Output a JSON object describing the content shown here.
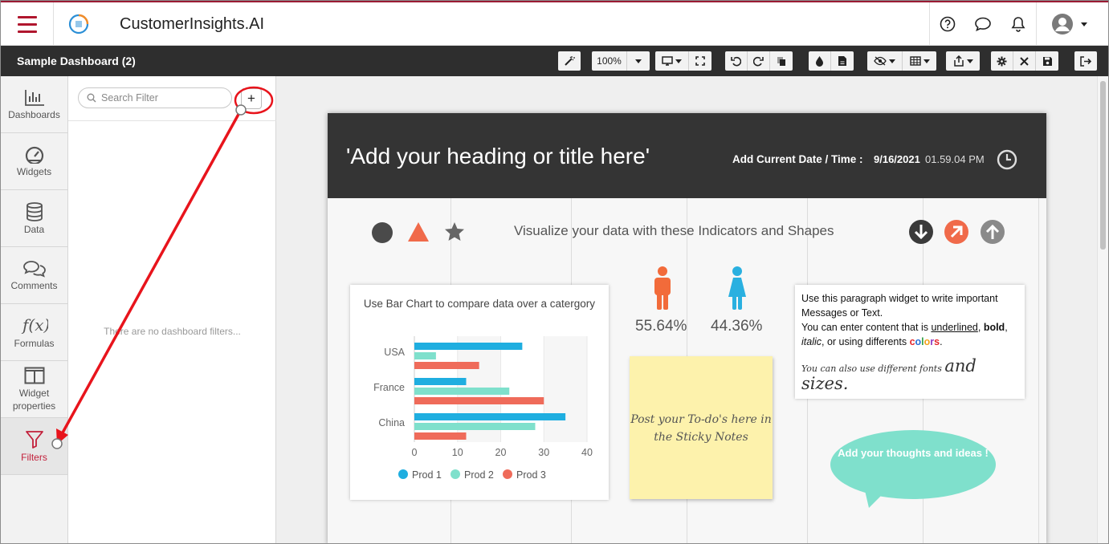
{
  "app": {
    "title": "CustomerInsights.AI",
    "logo_text": "customer insights"
  },
  "header": {
    "icons": [
      "help-icon",
      "chat-icon",
      "bell-icon",
      "user-avatar-icon"
    ]
  },
  "toolbar": {
    "dashboard_title": "Sample Dashboard (2)",
    "zoom": "100%"
  },
  "nav": {
    "items": [
      {
        "label": "Dashboards",
        "icon": "bar-chart-icon"
      },
      {
        "label": "Widgets",
        "icon": "gauge-icon"
      },
      {
        "label": "Data",
        "icon": "database-icon"
      },
      {
        "label": "Comments",
        "icon": "comments-icon"
      },
      {
        "label": "Formulas",
        "icon": "function-icon"
      },
      {
        "label": "Widget properties",
        "icon": "columns-icon"
      },
      {
        "label": "Filters",
        "icon": "filter-icon"
      }
    ],
    "active": "Filters"
  },
  "filter_panel": {
    "search_placeholder": "Search Filter",
    "add_label": "+",
    "empty_message": "There are no dashboard filters..."
  },
  "board": {
    "heading": "'Add your heading or title here'",
    "date_label": "Add Current Date / Time :",
    "date": "9/16/2021",
    "time": "01.59.04 PM",
    "indicators_text": "Visualize your data with these Indicators and Shapes",
    "male_pct": "55.64%",
    "female_pct": "44.36%",
    "paragraph": {
      "line1": "Use this paragraph widget to write important Messages or Text.",
      "line2_pre": "You can enter content that is ",
      "underlined": "underlined",
      "comma1": ", ",
      "bold": "bold",
      "comma2": ",",
      "italic": "italic",
      "line3_mid": ", or using differents ",
      "colors": "colors",
      "period": ".",
      "fonts": "You can also use different fonts",
      "sizes": "and sizes."
    },
    "sticky_note": "Post your To-do's here in the Sticky Notes",
    "bubble": "Add your thoughts and ideas !",
    "colors": {
      "accent": "#c21f3a",
      "orange": "#f26b3a",
      "blue": "#2ab0e0",
      "teal": "#7fe0cc",
      "sticky": "#fdf2ac"
    }
  },
  "chart_data": {
    "type": "bar",
    "orientation": "horizontal",
    "title": "Use Bar Chart to compare data over a catergory",
    "categories": [
      "USA",
      "France",
      "China"
    ],
    "series": [
      {
        "name": "Prod 1",
        "color": "#1faee0",
        "values": [
          25,
          12,
          35
        ]
      },
      {
        "name": "Prod 2",
        "color": "#7fe0cc",
        "values": [
          5,
          22,
          28
        ]
      },
      {
        "name": "Prod 3",
        "color": "#ef6b5a",
        "values": [
          15,
          30,
          12
        ]
      }
    ],
    "xlim": [
      0,
      40
    ],
    "xticks": [
      0,
      10,
      20,
      30,
      40
    ],
    "legend": "bottom"
  }
}
